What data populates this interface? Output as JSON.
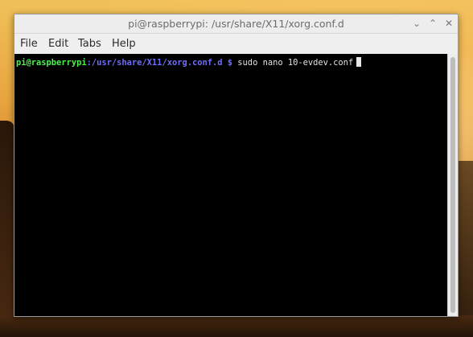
{
  "window": {
    "title": "pi@raspberrypi: /usr/share/X11/xorg.conf.d",
    "controls": {
      "minimize_icon": "⌄",
      "maximize_icon": "⌃",
      "close_icon": "✕"
    }
  },
  "menu": {
    "items": [
      {
        "label": "File"
      },
      {
        "label": "Edit"
      },
      {
        "label": "Tabs"
      },
      {
        "label": "Help"
      }
    ]
  },
  "terminal": {
    "prompt_user": "pi@raspberrypi",
    "prompt_colon": ":",
    "prompt_path": "/usr/share/X11/xorg.conf.d $",
    "command": "sudo nano 10-evdev.conf"
  },
  "colors": {
    "prompt_user": "#4ef24e",
    "prompt_path": "#6e6ef7",
    "terminal_bg": "#000000"
  }
}
